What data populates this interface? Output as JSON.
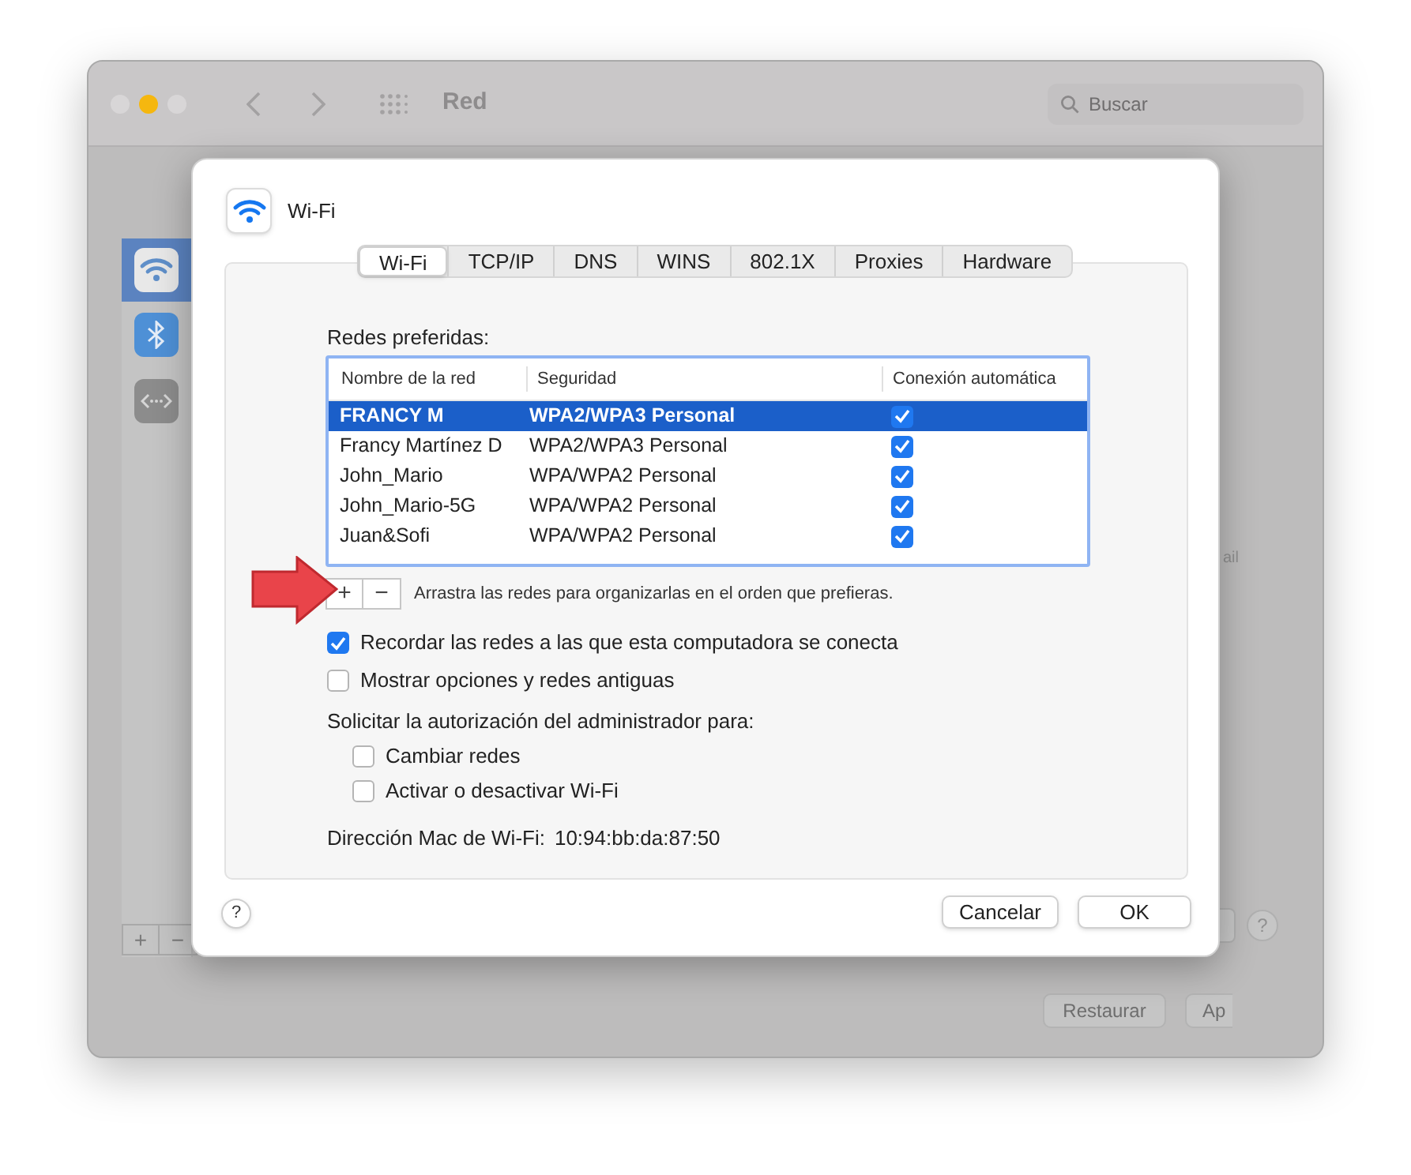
{
  "window": {
    "title": "Red",
    "search": {
      "placeholder": "Buscar"
    }
  },
  "sidebar": {
    "items": [
      {
        "kind": "wifi",
        "selected": true
      },
      {
        "kind": "bluetooth",
        "selected": false
      },
      {
        "kind": "ethernet",
        "selected": false
      }
    ],
    "add": "+",
    "remove": "−"
  },
  "background": {
    "partial_label": "ail",
    "help": "?",
    "buttons": [
      "Restaurar",
      "Ap"
    ]
  },
  "sheet": {
    "title": "Wi-Fi",
    "tabs": [
      {
        "label": "Wi-Fi",
        "selected": true
      },
      {
        "label": "TCP/IP",
        "selected": false
      },
      {
        "label": "DNS",
        "selected": false
      },
      {
        "label": "WINS",
        "selected": false
      },
      {
        "label": "802.1X",
        "selected": false
      },
      {
        "label": "Proxies",
        "selected": false
      },
      {
        "label": "Hardware",
        "selected": false
      }
    ],
    "preferred_label": "Redes preferidas:",
    "table": {
      "columns": [
        "Nombre de la red",
        "Seguridad",
        "Conexión automática"
      ],
      "rows": [
        {
          "name": "FRANCY M",
          "security": "WPA2/WPA3 Personal",
          "auto_join": true,
          "selected": true
        },
        {
          "name": "Francy Martínez D",
          "security": "WPA2/WPA3 Personal",
          "auto_join": true,
          "selected": false
        },
        {
          "name": "John_Mario",
          "security": "WPA/WPA2 Personal",
          "auto_join": true,
          "selected": false
        },
        {
          "name": "John_Mario-5G",
          "security": "WPA/WPA2 Personal",
          "auto_join": true,
          "selected": false
        },
        {
          "name": "Juan&Sofi",
          "security": "WPA/WPA2 Personal",
          "auto_join": true,
          "selected": false
        }
      ]
    },
    "add": "+",
    "remove": "−",
    "hint": "Arrastra las redes para organizarlas en el orden que prefieras.",
    "options": [
      {
        "label": "Recordar las redes a las que esta computadora se conecta",
        "checked": true
      },
      {
        "label": "Mostrar opciones y redes antiguas",
        "checked": false
      }
    ],
    "admin_label": "Solicitar la autorización del administrador para:",
    "admin_options": [
      {
        "label": "Cambiar redes",
        "checked": false
      },
      {
        "label": "Activar o desactivar Wi-Fi",
        "checked": false
      }
    ],
    "mac_label": "Dirección Mac de Wi-Fi:",
    "mac_value": "10:94:bb:da:87:50",
    "help": "?",
    "cancel": "Cancelar",
    "ok": "OK"
  }
}
